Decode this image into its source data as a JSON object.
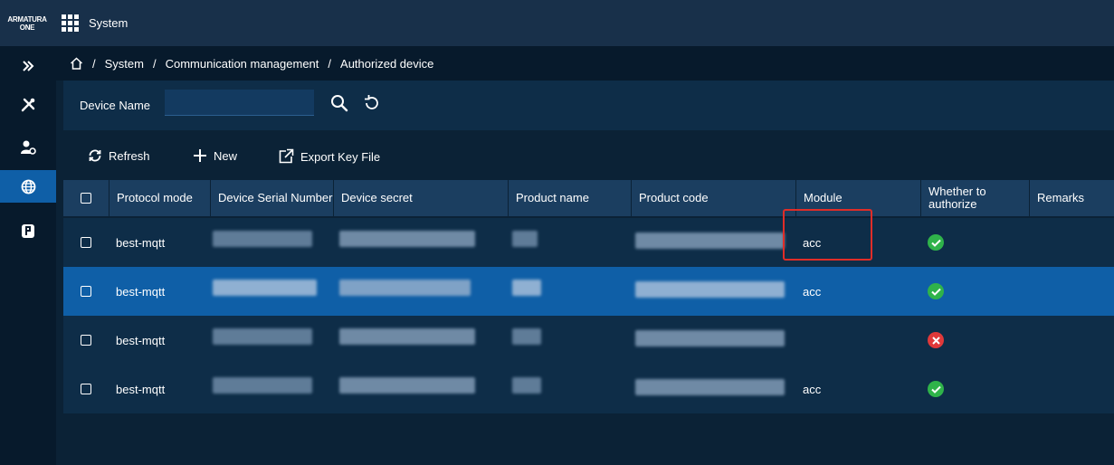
{
  "header": {
    "logo_line1": "ARMATURA",
    "logo_line2": "ONE",
    "title": "System"
  },
  "sidebar": {
    "items": [
      {
        "icon": "expand-icon"
      },
      {
        "icon": "tools-icon"
      },
      {
        "icon": "user-settings-icon"
      },
      {
        "icon": "globe-icon",
        "active": true
      },
      {
        "icon": "device-icon"
      }
    ]
  },
  "breadcrumb": {
    "items": [
      "System",
      "Communication management",
      "Authorized device"
    ]
  },
  "filter": {
    "device_name_label": "Device Name",
    "device_name_value": ""
  },
  "toolbar": {
    "refresh_label": "Refresh",
    "new_label": "New",
    "export_label": "Export Key File"
  },
  "table": {
    "headers": [
      "Protocol mode",
      "Device Serial Number",
      "Device secret",
      "Product name",
      "Product code",
      "Module",
      "Whether to authorize",
      "Remarks"
    ],
    "rows": [
      {
        "protocol": "best-mqtt",
        "module": "acc",
        "authorized": true,
        "selected": false
      },
      {
        "protocol": "best-mqtt",
        "module": "acc",
        "authorized": true,
        "selected": true
      },
      {
        "protocol": "best-mqtt",
        "module": "",
        "authorized": false,
        "selected": false
      },
      {
        "protocol": "best-mqtt",
        "module": "acc",
        "authorized": true,
        "selected": false
      }
    ]
  },
  "colors": {
    "highlight": "#e02d28",
    "success": "#2fb34a",
    "danger": "#e0393a",
    "selected_row": "#0f5fa7"
  }
}
